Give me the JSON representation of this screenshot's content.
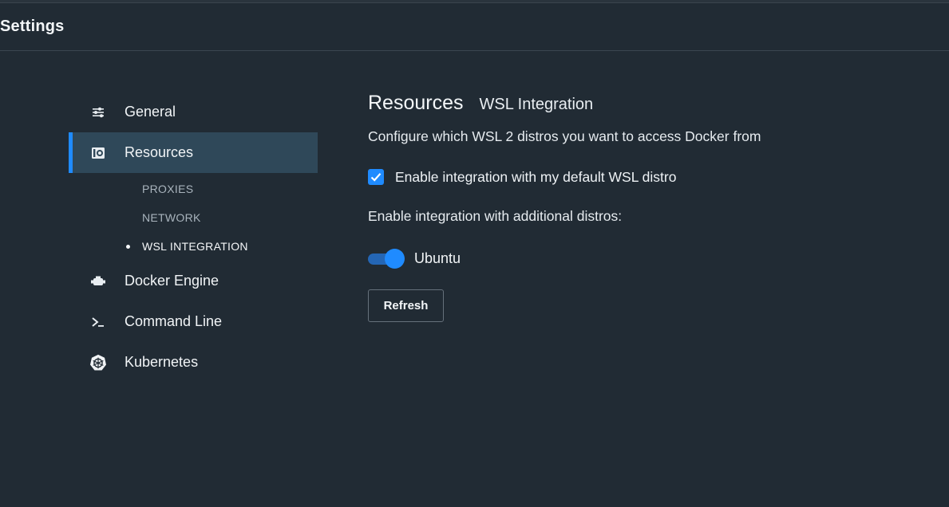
{
  "header": {
    "title": "Settings"
  },
  "sidebar": {
    "items": [
      {
        "label": "General",
        "icon": "sliders-icon"
      },
      {
        "label": "Resources",
        "icon": "resources-icon",
        "active": true
      },
      {
        "label": "Docker Engine",
        "icon": "engine-icon"
      },
      {
        "label": "Command Line",
        "icon": "terminal-icon"
      },
      {
        "label": "Kubernetes",
        "icon": "kubernetes-icon"
      }
    ],
    "subitems": [
      {
        "label": "PROXIES"
      },
      {
        "label": "NETWORK"
      },
      {
        "label": "WSL INTEGRATION",
        "current": true
      }
    ]
  },
  "main": {
    "title": "Resources",
    "subtitle": "WSL Integration",
    "description": "Configure which WSL 2 distros you want to access Docker from",
    "default_distro": {
      "label": "Enable integration with my default WSL distro",
      "checked": true
    },
    "additional_label": "Enable integration with additional distros:",
    "distros": [
      {
        "name": "Ubuntu",
        "enabled": true
      }
    ],
    "refresh_label": "Refresh"
  },
  "colors": {
    "background": "#212b34",
    "accent": "#1f8bff",
    "active_nav": "#2f4859"
  }
}
